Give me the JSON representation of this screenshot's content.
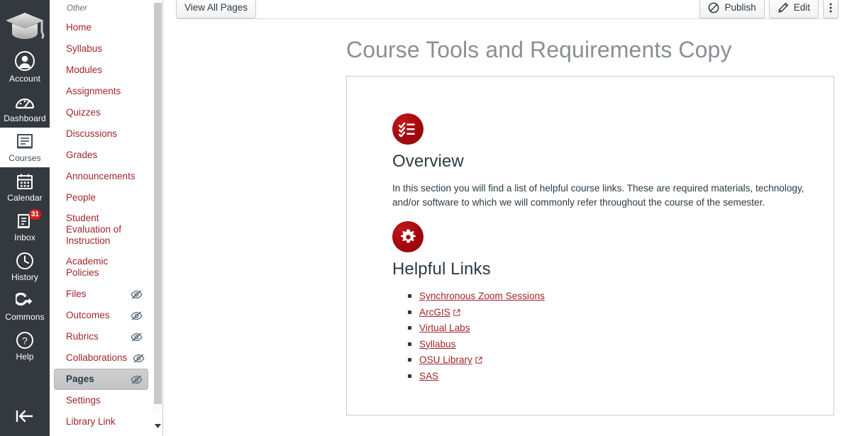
{
  "global_nav": {
    "logo_name": "graduation-cap-logo",
    "items": [
      {
        "label": "Account",
        "icon": "account-icon",
        "active": false,
        "badge": null
      },
      {
        "label": "Dashboard",
        "icon": "dashboard-icon",
        "active": false,
        "badge": null
      },
      {
        "label": "Courses",
        "icon": "courses-icon",
        "active": true,
        "badge": null
      },
      {
        "label": "Calendar",
        "icon": "calendar-icon",
        "active": false,
        "badge": null
      },
      {
        "label": "Inbox",
        "icon": "inbox-icon",
        "active": false,
        "badge": "31"
      },
      {
        "label": "History",
        "icon": "history-clock-icon",
        "active": false,
        "badge": null
      },
      {
        "label": "Commons",
        "icon": "commons-icon",
        "active": false,
        "badge": null
      },
      {
        "label": "Help",
        "icon": "help-question-icon",
        "active": false,
        "badge": null
      }
    ],
    "collapse_icon": "collapse-left-arrow-icon"
  },
  "course_nav": {
    "group_label": "Other",
    "items": [
      {
        "label": "Home",
        "hidden": false,
        "active": false
      },
      {
        "label": "Syllabus",
        "hidden": false,
        "active": false
      },
      {
        "label": "Modules",
        "hidden": false,
        "active": false
      },
      {
        "label": "Assignments",
        "hidden": false,
        "active": false
      },
      {
        "label": "Quizzes",
        "hidden": false,
        "active": false
      },
      {
        "label": "Discussions",
        "hidden": false,
        "active": false
      },
      {
        "label": "Grades",
        "hidden": false,
        "active": false
      },
      {
        "label": "Announcements",
        "hidden": false,
        "active": false
      },
      {
        "label": "People",
        "hidden": false,
        "active": false
      },
      {
        "label": "Student Evaluation of Instruction",
        "hidden": false,
        "active": false
      },
      {
        "label": "Academic Policies",
        "hidden": false,
        "active": false
      },
      {
        "label": "Files",
        "hidden": true,
        "active": false
      },
      {
        "label": "Outcomes",
        "hidden": true,
        "active": false
      },
      {
        "label": "Rubrics",
        "hidden": true,
        "active": false
      },
      {
        "label": "Collaborations",
        "hidden": true,
        "active": false
      },
      {
        "label": "Pages",
        "hidden": true,
        "active": true
      },
      {
        "label": "Settings",
        "hidden": false,
        "active": false
      },
      {
        "label": "Library Link",
        "hidden": false,
        "active": false
      }
    ],
    "hidden_icon": "eye-slash-icon",
    "scroll_down_icon": "scroll-down-arrow-icon"
  },
  "toolbar": {
    "view_all_pages_label": "View All Pages",
    "publish_label": "Publish",
    "publish_icon": "unpublished-circle-slash-icon",
    "edit_label": "Edit",
    "edit_icon": "pencil-icon",
    "kebab_icon": "more-options-kebab-icon"
  },
  "page": {
    "title": "Course Tools and Requirements Copy"
  },
  "sections": [
    {
      "icon": "checklist-icon",
      "heading": "Overview",
      "body": "In this section you will find a list of helpful course links. These are required materials, technology, and/or software to which we will commonly refer throughout the course of the semester."
    },
    {
      "icon": "gear-icon",
      "heading": "Helpful Links",
      "links": [
        {
          "label": "Synchronous Zoom Sessions",
          "external": false
        },
        {
          "label": "ArcGIS",
          "external": true
        },
        {
          "label": "Virtual Labs",
          "external": false
        },
        {
          "label": "Syllabus",
          "external": false
        },
        {
          "label": "OSU Library",
          "external": true
        },
        {
          "label": "SAS",
          "external": false
        }
      ]
    }
  ],
  "colors": {
    "brand_red": "#a2262c",
    "icon_red": "#a3080c",
    "global_nav_bg": "#33393e",
    "badge_red": "#d02020",
    "title_gray": "#8a8f94"
  }
}
